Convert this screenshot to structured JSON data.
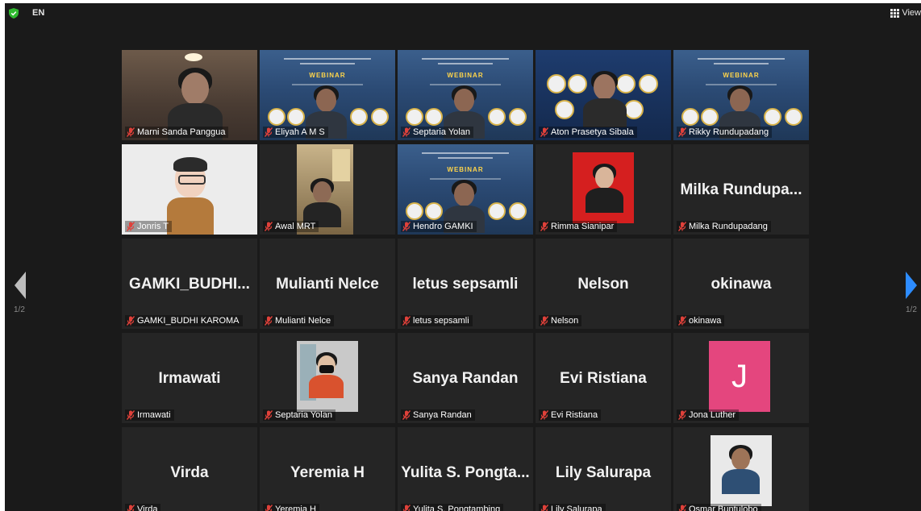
{
  "topbar": {
    "language": "EN",
    "view_label": "View"
  },
  "pagination": {
    "left_page": "1/2",
    "right_page": "1/2"
  },
  "participants": [
    {
      "name": "Marni Sanda Panggua",
      "display": "",
      "video": "room",
      "active": true
    },
    {
      "name": "Eliyah A M S",
      "display": "",
      "video": "webinar"
    },
    {
      "name": "Septaria Yolan",
      "display": "",
      "video": "webinar"
    },
    {
      "name": "Aton Prasetya Sibala",
      "display": "",
      "video": "webinar2"
    },
    {
      "name": "Rikky Rundupadang",
      "display": "",
      "video": "webinar"
    },
    {
      "name": "Jonris T",
      "display": "",
      "video": "avatar"
    },
    {
      "name": "Awal MRT",
      "display": "",
      "video": "office"
    },
    {
      "name": "Hendro GAMKI",
      "display": "",
      "video": "webinar"
    },
    {
      "name": "Rimma Sianipar",
      "display": "",
      "video": "portrait-red"
    },
    {
      "name": "Milka Rundupadang",
      "display": "Milka Rundupa...",
      "video": "none"
    },
    {
      "name": "GAMKI_BUDHI KAROMA",
      "display": "GAMKI_BUDHI...",
      "video": "none"
    },
    {
      "name": "Mulianti Nelce",
      "display": "Mulianti Nelce",
      "video": "none"
    },
    {
      "name": "letus sepsamli",
      "display": "letus sepsamli",
      "video": "none"
    },
    {
      "name": "Nelson",
      "display": "Nelson",
      "video": "none"
    },
    {
      "name": "okinawa",
      "display": "okinawa",
      "video": "none"
    },
    {
      "name": "Irmawati",
      "display": "Irmawati",
      "video": "none"
    },
    {
      "name": "Septaria Yolan",
      "display": "",
      "video": "photo-mask"
    },
    {
      "name": "Sanya Randan",
      "display": "Sanya Randan",
      "video": "none"
    },
    {
      "name": "Evi Ristiana",
      "display": "Evi Ristiana",
      "video": "none"
    },
    {
      "name": "Jona Luther",
      "display": "",
      "video": "letter",
      "initial": "J"
    },
    {
      "name": "Virda",
      "display": "Virda",
      "video": "none"
    },
    {
      "name": "Yeremia H",
      "display": "Yeremia H",
      "video": "none"
    },
    {
      "name": "Yulita S. Pongtambing",
      "display": "Yulita S. Pongta...",
      "video": "none"
    },
    {
      "name": "Lily Salurapa",
      "display": "Lily Salurapa",
      "video": "none"
    },
    {
      "name": "Osmar Buntulobo",
      "display": "",
      "video": "photo-man"
    }
  ],
  "webinar": {
    "headline": "WEBINAR"
  },
  "colors": {
    "active_border": "#c7df6a",
    "nav_arrow_right": "#2d8cff",
    "nav_arrow_left": "#bdbdbd",
    "muted_icon": "#e0413a",
    "tile_bg": "#252525"
  },
  "icons": {
    "muted": "mic-muted-icon",
    "security": "shield-icon",
    "view": "grid-view-icon"
  }
}
